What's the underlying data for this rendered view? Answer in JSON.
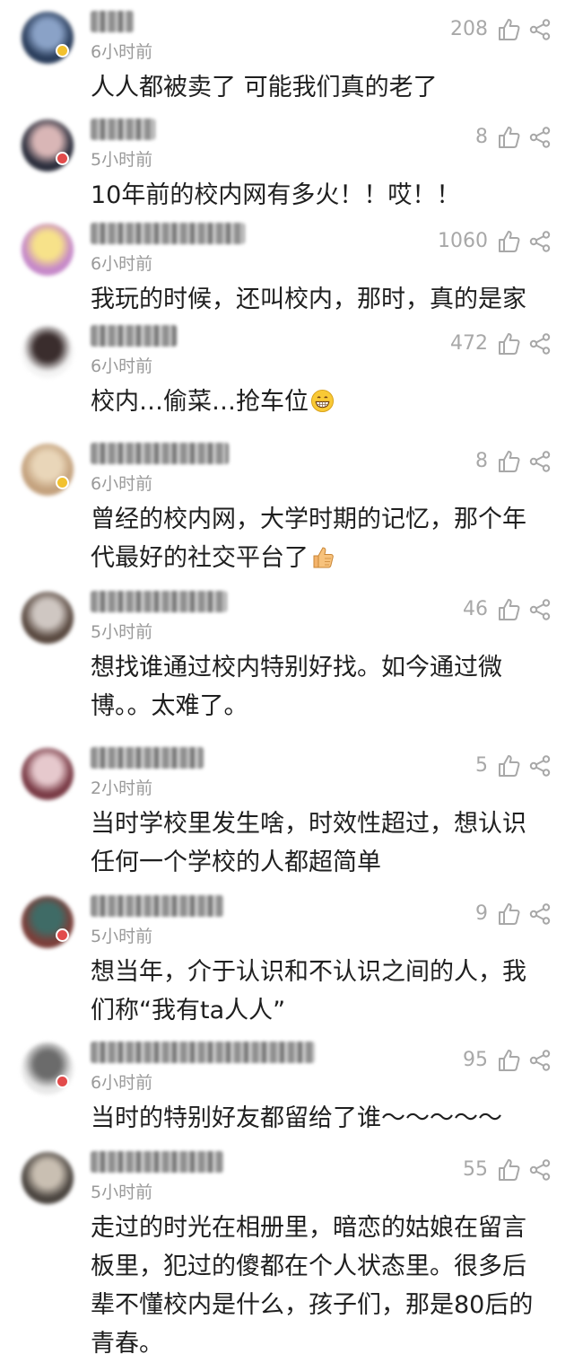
{
  "colors": {
    "text_primary": "#1f1f1f",
    "text_muted": "#9a9a9a",
    "icon_gray": "#a8a8a8",
    "badge_yellow": "#f2c12e",
    "badge_red": "#e24b4b"
  },
  "icons": {
    "like": "thumbs-up-outline-icon",
    "share": "share-icon"
  },
  "comments": [
    {
      "time": "6小时前",
      "likes": "208",
      "lines": [
        "人人都被卖了 可能我们真的老了"
      ],
      "name_blur_width": 48,
      "avatar_colors": [
        "#2b3e5c",
        "#8aa2c7"
      ],
      "badge": "badge_yellow"
    },
    {
      "time": "5小时前",
      "likes": "8",
      "lines": [
        "10年前的校内网有多火！！哎！！"
      ],
      "name_blur_width": 72,
      "avatar_colors": [
        "#2c2f3d",
        "#d9b6b6"
      ],
      "badge": "badge_red"
    },
    {
      "time": "6小时前",
      "likes": "1060",
      "lines": [
        "我玩的时候，还叫校内，那时，真的是家"
      ],
      "name_blur_width": 172,
      "avatar_colors": [
        "#c689c9",
        "#f7e28a"
      ],
      "badge": ""
    },
    {
      "time": "6小时前",
      "likes": "472",
      "lines": [
        "校内…偷菜…抢车位"
      ],
      "emoji": "grin",
      "name_blur_width": 96,
      "avatar_colors": [
        "#f4f4f4",
        "#3a2d2d"
      ],
      "badge": ""
    },
    {
      "time": "6小时前",
      "likes": "8",
      "lines": [
        "曾经的校内网，大学时期的记忆，那个年",
        "代最好的社交平台了"
      ],
      "emoji": "thumbsup",
      "name_blur_width": 154,
      "avatar_colors": [
        "#c4a27e",
        "#e9d6b9"
      ],
      "badge": "badge_yellow"
    },
    {
      "time": "5小时前",
      "likes": "46",
      "lines": [
        "想找谁通过校内特别好找。如今通过微",
        "博。。太难了。"
      ],
      "name_blur_width": 152,
      "avatar_colors": [
        "#5a4a41",
        "#cfc7c2"
      ],
      "badge": ""
    },
    {
      "time": "2小时前",
      "likes": "5",
      "lines": [
        "当时学校里发生啥，时效性超过，想认识",
        "任何一个学校的人都超简单"
      ],
      "name_blur_width": 126,
      "avatar_colors": [
        "#7a3b46",
        "#e6c9cd"
      ],
      "badge": ""
    },
    {
      "time": "5小时前",
      "likes": "9",
      "lines": [
        "想当年，介于认识和不认识之间的人，我",
        "们称“我有ta人人”"
      ],
      "name_blur_width": 148,
      "avatar_colors": [
        "#7b3f3a",
        "#3f6b66"
      ],
      "badge": "badge_red"
    },
    {
      "time": "6小时前",
      "likes": "95",
      "lines": [
        "当时的特别好友都留给了谁～～～～～"
      ],
      "name_blur_width": 250,
      "avatar_colors": [
        "#e9e9e9",
        "#6b6b6b"
      ],
      "badge": "badge_red"
    },
    {
      "time": "5小时前",
      "likes": "55",
      "lines": [
        "走过的时光在相册里，暗恋的姑娘在留言",
        "板里，犯过的傻都在个人状态里。很多后",
        "辈不懂校内是什么，孩子们，那是80后的",
        "青春。"
      ],
      "name_blur_width": 148,
      "avatar_colors": [
        "#4b4540",
        "#c9bfb2"
      ],
      "badge": ""
    }
  ]
}
